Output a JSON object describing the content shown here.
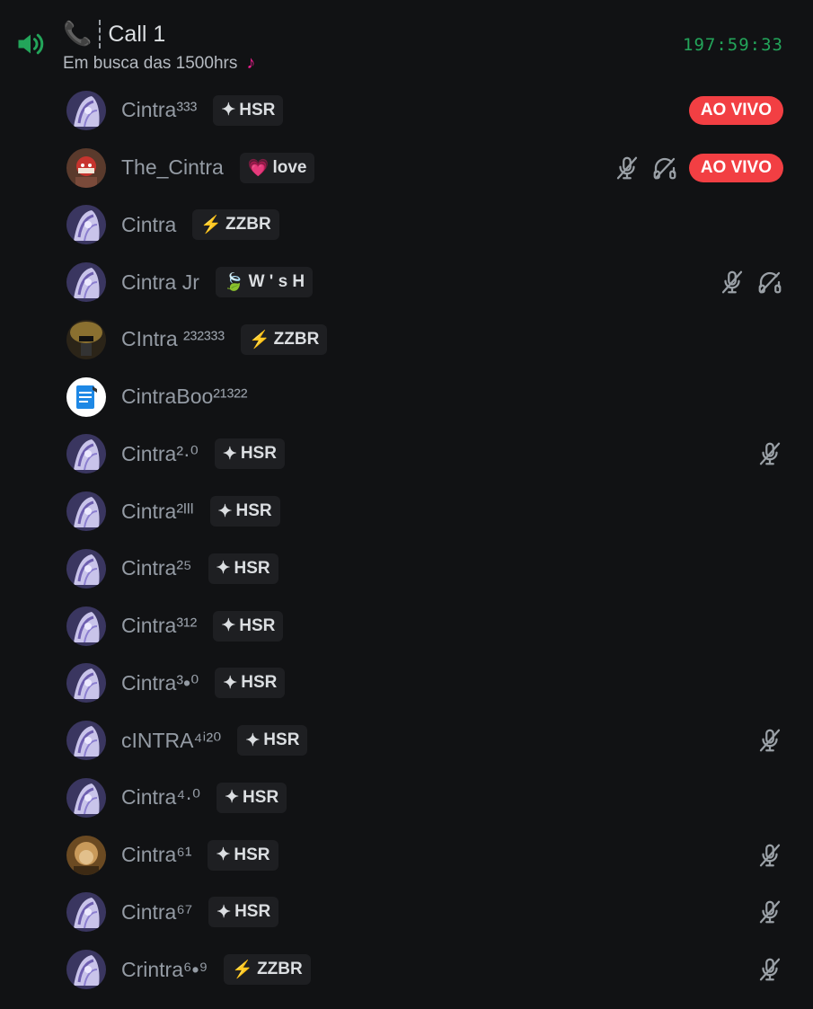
{
  "channel": {
    "title": "Call 1",
    "subtitle": "Em busca das 1500hrs",
    "timer": "197:59:33",
    "phone_icon": "📞",
    "subtitle_icon": "♪"
  },
  "colors": {
    "background": "#111214",
    "timer": "#23a55a",
    "live": "#f23f43",
    "speaker": "#23a55a"
  },
  "members": [
    {
      "name": "Cintra³³³",
      "badge_icon": "✦",
      "badge": "HSR",
      "live": "AO VIVO",
      "muted": false,
      "deafened": false,
      "avatar": "anime"
    },
    {
      "name": "The_Cintra",
      "badge_icon": "💗",
      "badge": "love",
      "live": "AO VIVO",
      "muted": true,
      "deafened": true,
      "avatar": "red"
    },
    {
      "name": "Cintra",
      "badge_icon": "⚡",
      "badge": "ZZBR",
      "live": "",
      "muted": false,
      "deafened": false,
      "avatar": "anime"
    },
    {
      "name": "Cintra Jr",
      "badge_icon": "🍃",
      "badge": "W ' s H",
      "live": "",
      "muted": true,
      "deafened": true,
      "avatar": "anime"
    },
    {
      "name": "CIntra ²³²³³³",
      "badge_icon": "⚡",
      "badge": "ZZBR",
      "live": "",
      "muted": false,
      "deafened": false,
      "avatar": "dark"
    },
    {
      "name": "CintraBoo²¹³²²",
      "badge_icon": "",
      "badge": "",
      "live": "",
      "muted": false,
      "deafened": false,
      "avatar": "doc"
    },
    {
      "name": "Cintra²·⁰",
      "badge_icon": "✦",
      "badge": "HSR",
      "live": "",
      "muted": true,
      "deafened": false,
      "avatar": "anime"
    },
    {
      "name": "Cintra²ᴵᴵᴵ",
      "badge_icon": "✦",
      "badge": "HSR",
      "live": "",
      "muted": false,
      "deafened": false,
      "avatar": "anime"
    },
    {
      "name": "Cintra²⁵",
      "badge_icon": "✦",
      "badge": "HSR",
      "live": "",
      "muted": false,
      "deafened": false,
      "avatar": "anime"
    },
    {
      "name": "Cintra³¹²",
      "badge_icon": "✦",
      "badge": "HSR",
      "live": "",
      "muted": false,
      "deafened": false,
      "avatar": "anime"
    },
    {
      "name": "Cintra³•⁰",
      "badge_icon": "✦",
      "badge": "HSR",
      "live": "",
      "muted": false,
      "deafened": false,
      "avatar": "anime"
    },
    {
      "name": "cINTRA⁴ⁱ²⁰",
      "badge_icon": "✦",
      "badge": "HSR",
      "live": "",
      "muted": true,
      "deafened": false,
      "avatar": "anime"
    },
    {
      "name": "Cintra⁴·⁰",
      "badge_icon": "✦",
      "badge": "HSR",
      "live": "",
      "muted": false,
      "deafened": false,
      "avatar": "anime"
    },
    {
      "name": "Cintra⁶¹",
      "badge_icon": "✦",
      "badge": "HSR",
      "live": "",
      "muted": true,
      "deafened": false,
      "avatar": "gold"
    },
    {
      "name": "Cintra⁶⁷",
      "badge_icon": "✦",
      "badge": "HSR",
      "live": "",
      "muted": true,
      "deafened": false,
      "avatar": "anime"
    },
    {
      "name": "Crintra⁶•⁹",
      "badge_icon": "⚡",
      "badge": "ZZBR",
      "live": "",
      "muted": true,
      "deafened": false,
      "avatar": "anime"
    }
  ]
}
